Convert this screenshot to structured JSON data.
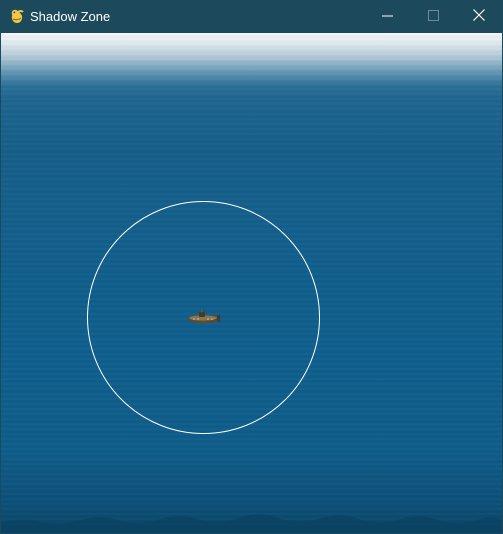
{
  "window": {
    "title": "Shadow Zone",
    "app_icon": "pygame-snake-icon",
    "controls": {
      "minimize_icon": "minimize-icon",
      "maximize_icon": "maximize-icon",
      "close_icon": "close-icon"
    }
  },
  "game": {
    "sprites": {
      "player": "submarine",
      "range_indicator": "detection-ring"
    },
    "colors": {
      "titlebar": "#1c4a5c",
      "surface": "#f2f6f8",
      "water": "#125f8d",
      "deep_water": "#0b4466",
      "ring": "#ffffff"
    }
  }
}
